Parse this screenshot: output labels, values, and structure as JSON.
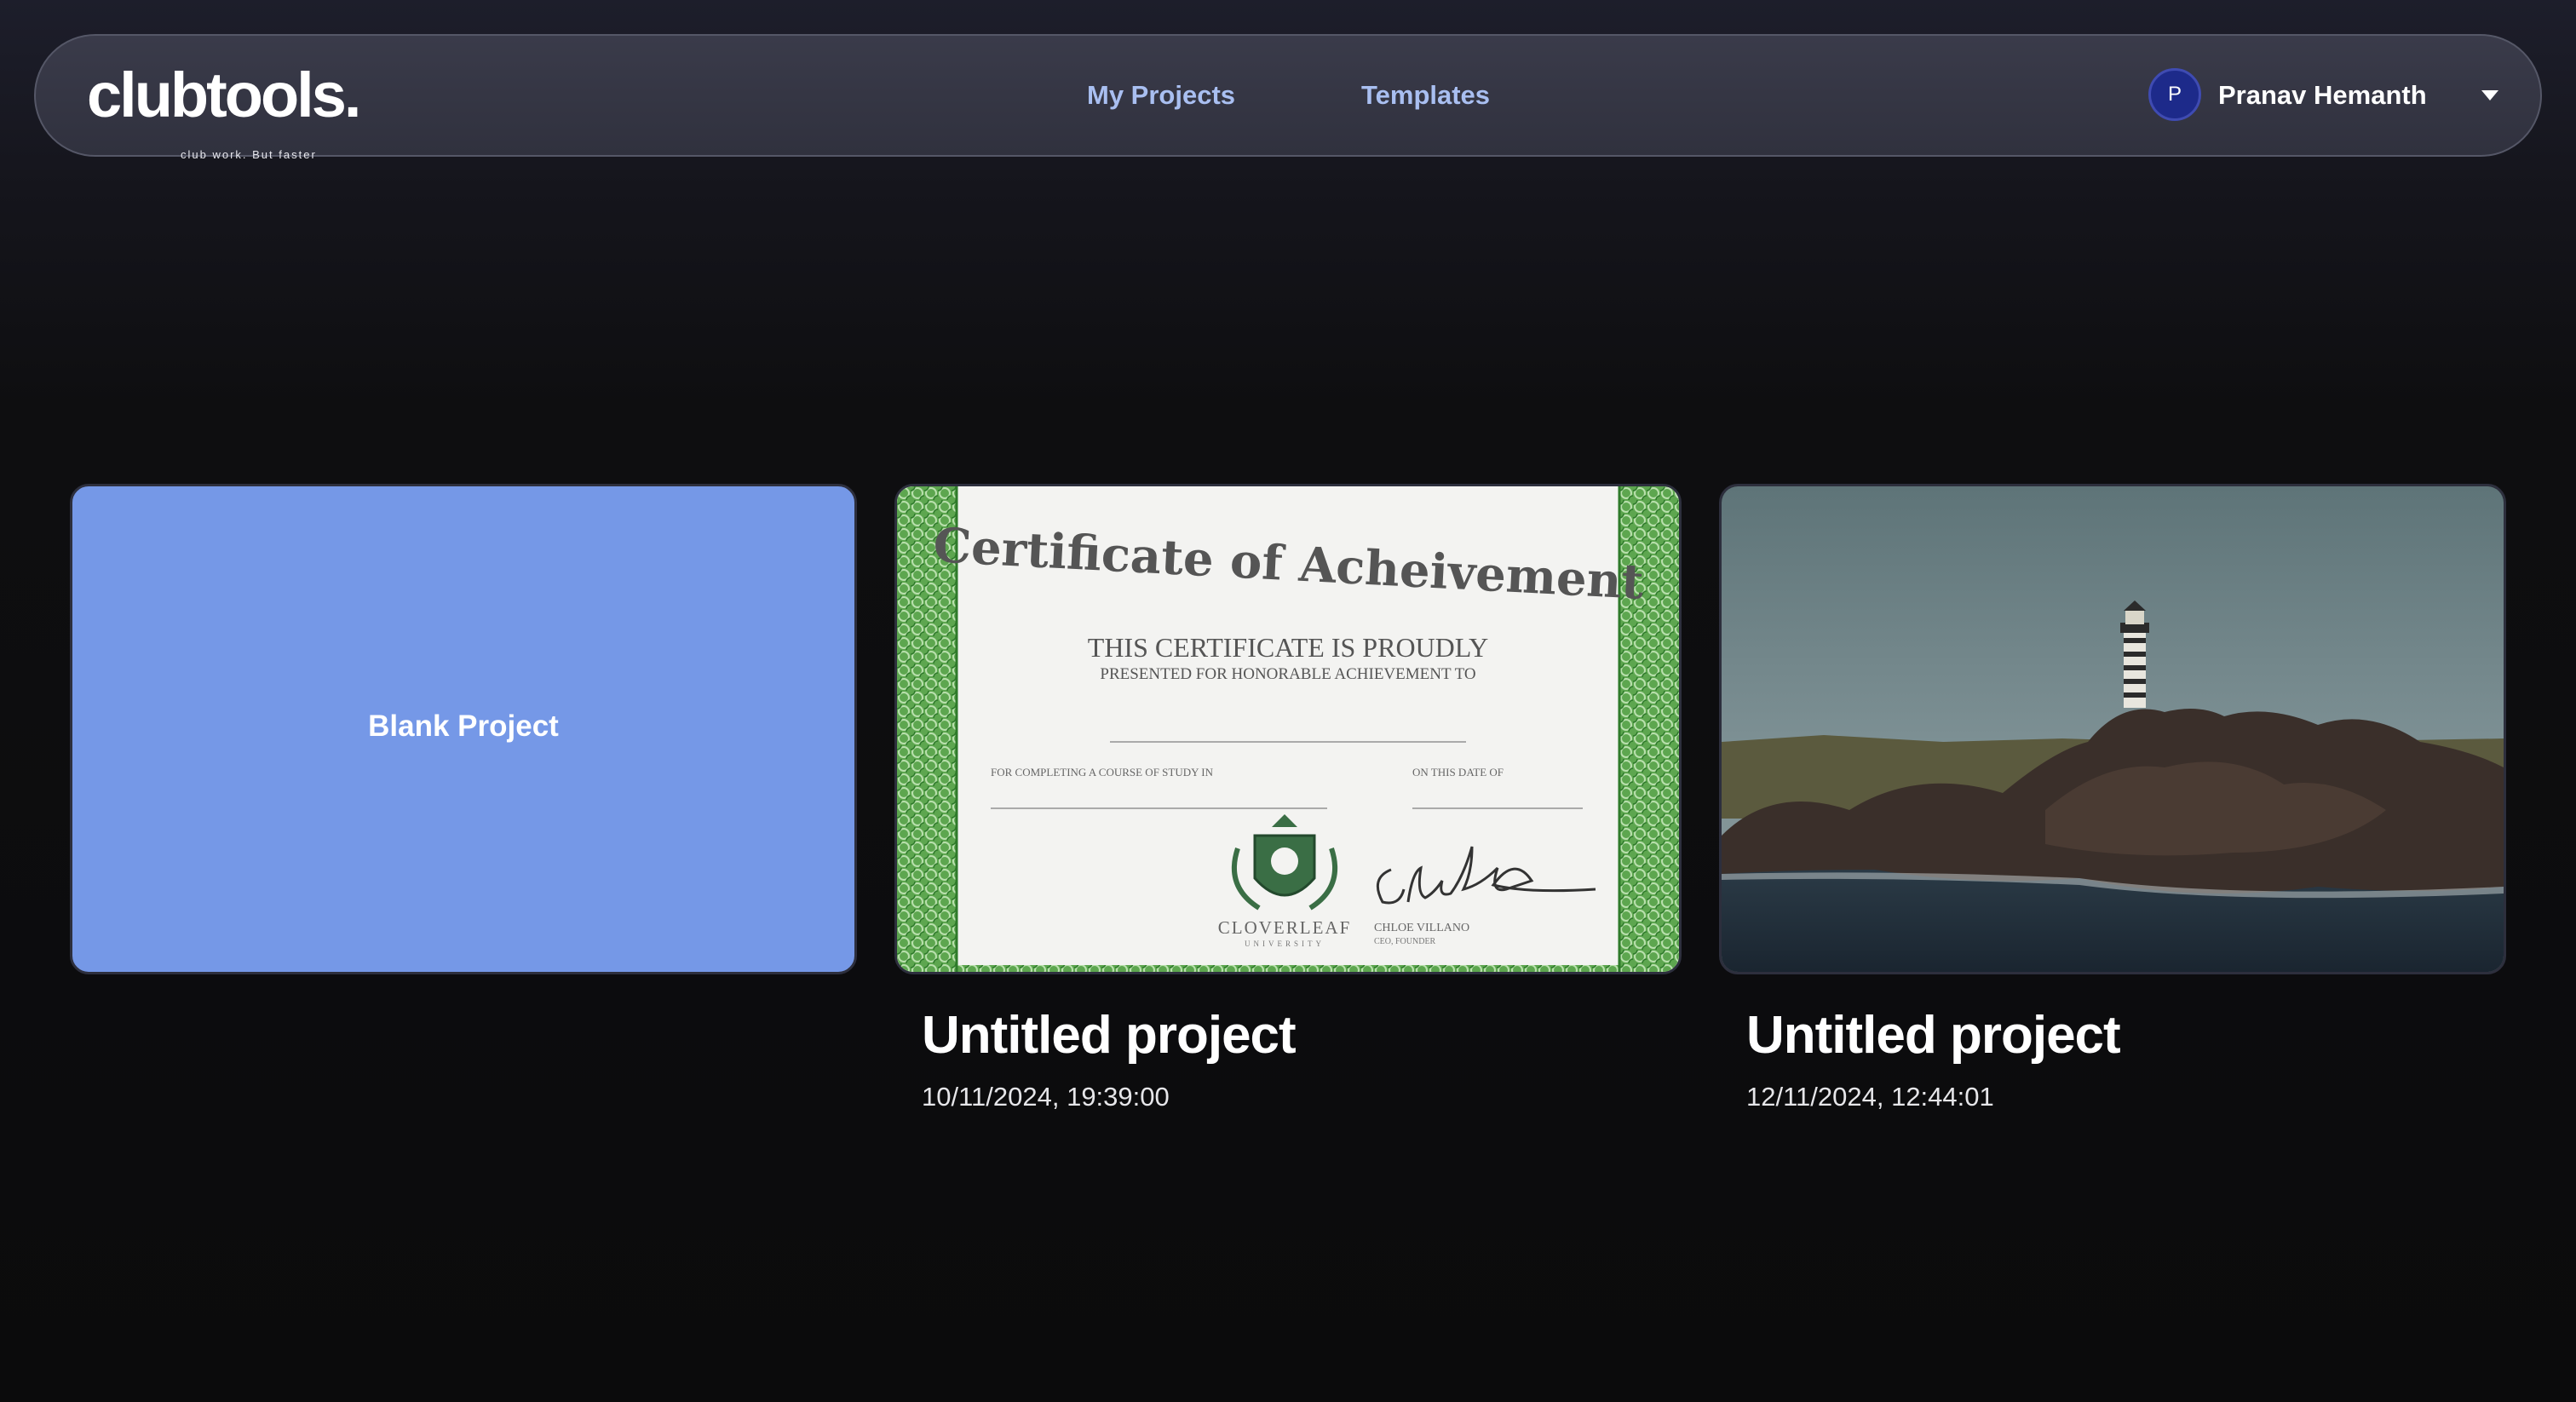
{
  "brand": {
    "name": "clubtools.",
    "tagline": "club work. But faster"
  },
  "nav": {
    "links": [
      {
        "label": "My Projects"
      },
      {
        "label": "Templates"
      }
    ],
    "user": {
      "initial": "P",
      "name": "Pranav Hemanth",
      "menu_icon": "caret-down-icon"
    }
  },
  "projects": {
    "blank": {
      "label": "Blank Project"
    },
    "items": [
      {
        "title": "Untitled project",
        "date": "10/11/2024, 19:39:00",
        "thumbnail": {
          "kind": "certificate",
          "heading": "Certificate of Acheivement",
          "line1": "THIS CERTIFICATE IS PROUDLY",
          "line2": "PRESENTED FOR HONORABLE ACHIEVEMENT TO",
          "field_left": "FOR COMPLETING A COURSE OF STUDY IN",
          "field_right": "ON THIS DATE OF",
          "institution": "CLOVERLEAF",
          "institution_sub": "UNIVERSITY",
          "signer": "CHLOE VILLANO",
          "signer_role": "CEO, FOUNDER"
        }
      },
      {
        "title": "Untitled project",
        "date": "12/11/2024, 12:44:01",
        "thumbnail": {
          "kind": "photo",
          "subject": "lighthouse-on-rocky-coast"
        }
      }
    ]
  },
  "colors": {
    "accent_link": "#a9bff1",
    "blank_card": "#7598e7",
    "avatar": "#1d2a8a",
    "certificate_border": "#4f9a45"
  }
}
